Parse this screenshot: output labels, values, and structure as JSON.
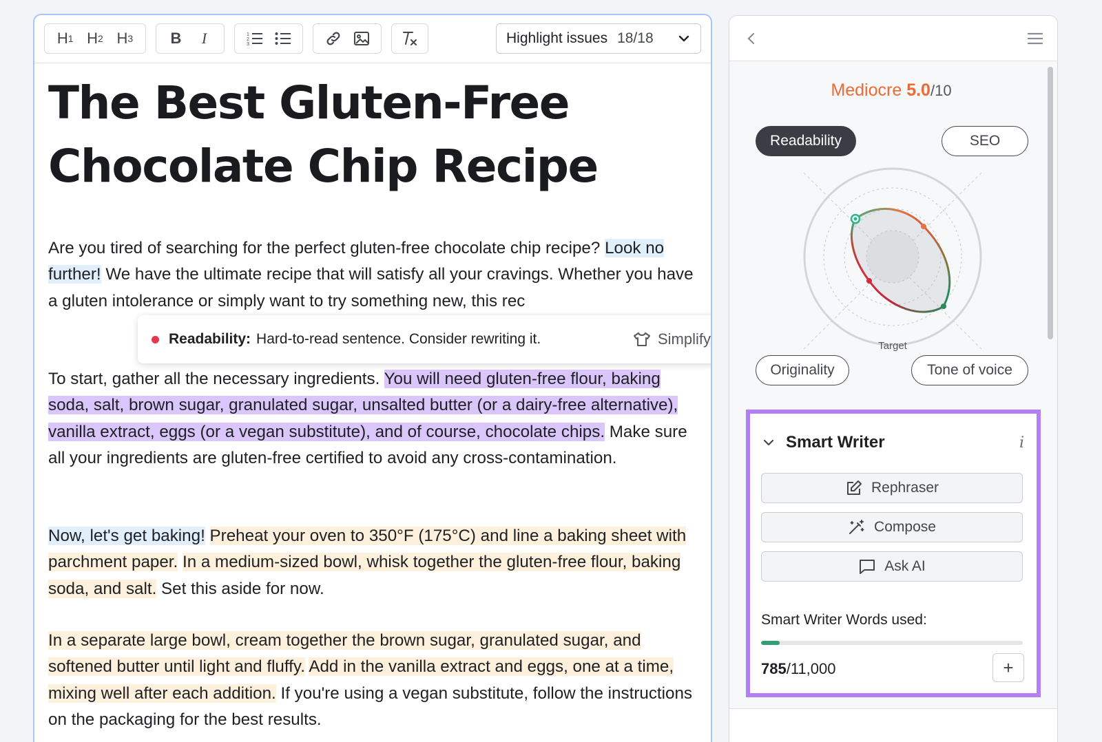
{
  "toolbar": {
    "headings": [
      {
        "name": "heading-1-button",
        "letter": "H",
        "level": "1"
      },
      {
        "name": "heading-2-button",
        "letter": "H",
        "level": "2"
      },
      {
        "name": "heading-3-button",
        "letter": "H",
        "level": "3"
      }
    ],
    "bold_label": "B",
    "italic_label": "I",
    "highlight_label": "Highlight issues",
    "highlight_count": "18/18"
  },
  "document": {
    "title": "The Best Gluten-Free Chocolate Chip Recipe",
    "p1": [
      {
        "text": "Are you tired of searching for the perfect gluten-free chocolate chip recipe? ",
        "hl": ""
      },
      {
        "text": "Look no further!",
        "hl": "blue"
      },
      {
        "text": " We have the ultimate recipe that will satisfy all your cravings. Whether you have a gluten intolerance or simply want to try something new, this rec",
        "hl": ""
      }
    ],
    "p2": [
      {
        "text": "To start, gather all the necessary ingredients. ",
        "hl": ""
      },
      {
        "text": "You will need gluten-free flour, baking soda, salt, brown sugar, granulated sugar, unsalted butter (or a dairy-free alternative), vanilla extract, eggs (or a vegan substitute), and of course, chocolate chips.",
        "hl": "purple"
      },
      {
        "text": " Make sure all your ingredients are gluten-free certified to avoid any cross-contamination.",
        "hl": ""
      }
    ],
    "p3": [
      {
        "text": "Now, let's get baking!",
        "hl": "blue"
      },
      {
        "text": " ",
        "hl": ""
      },
      {
        "text": "Preheat your oven to 350°F (175°C) and line a baking sheet with parchment paper.",
        "hl": "yellow"
      },
      {
        "text": " ",
        "hl": ""
      },
      {
        "text": "In a medium-sized bowl, whisk together the gluten-free flour, baking soda, and salt.",
        "hl": "yellow"
      },
      {
        "text": " Set this aside for now.",
        "hl": ""
      }
    ],
    "p4": [
      {
        "text": "In a separate large bowl, cream together the brown sugar, granulated sugar, and softened butter until light and fluffy.",
        "hl": "yellow"
      },
      {
        "text": " ",
        "hl": ""
      },
      {
        "text": "Add in the vanilla extract and eggs, one at a time, mixing well after each addition.",
        "hl": "yellow"
      },
      {
        "text": " If you're using a vegan substitute, follow the instructions on the packaging for the best results.",
        "hl": ""
      }
    ]
  },
  "tooltip": {
    "category": "Readability:",
    "message": "Hard-to-read sentence. Consider rewriting it.",
    "action": "Simplify"
  },
  "panel": {
    "score_word": "Mediocre",
    "score_value": "5.0",
    "score_max": "/10",
    "tabs": {
      "readability": "Readability",
      "seo": "SEO",
      "originality": "Originality",
      "tone": "Tone of voice"
    },
    "radar_target_label": "Target",
    "smart_writer": {
      "title": "Smart Writer",
      "info": "i",
      "rephraser": "Rephraser",
      "compose": "Compose",
      "ask_ai": "Ask AI",
      "words_label": "Smart Writer Words used:",
      "words_used": "785",
      "words_total": "/11,000",
      "words_fraction": 0.0714
    }
  },
  "colors": {
    "accent_orange": "#ee6a35",
    "smart_writer_border": "#b37ff5",
    "highlight_purple": "#dac6fb",
    "highlight_yellow": "#fdf1dd",
    "highlight_blue": "#e1eefc",
    "progress_green": "#2f9e71"
  }
}
